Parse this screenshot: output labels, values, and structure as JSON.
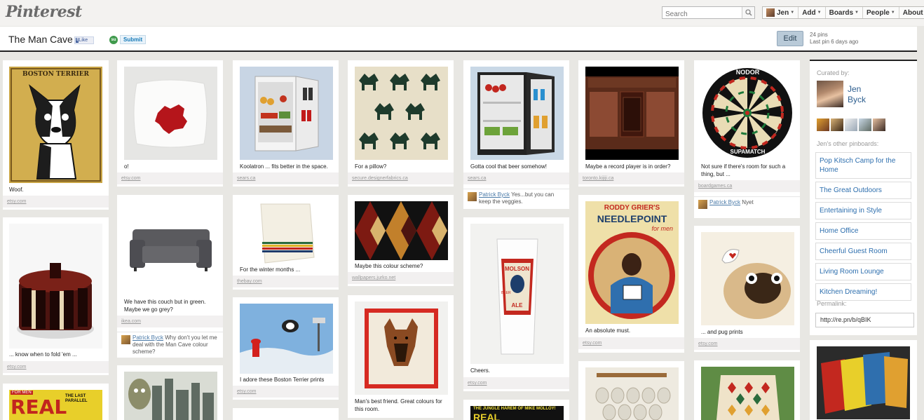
{
  "topbar": {
    "logo": "Pinterest",
    "search_placeholder": "Search",
    "nav": [
      {
        "label": "Jen"
      },
      {
        "label": "Add"
      },
      {
        "label": "Boards"
      },
      {
        "label": "People"
      },
      {
        "label": "About"
      }
    ]
  },
  "board": {
    "title": "The Man Cave",
    "fb_like": "Like",
    "su_label": "Submit",
    "edit": "Edit",
    "pin_count": "24 pins",
    "last_pin": "Last pin 6 days ago"
  },
  "pins": [
    {
      "caption": "Woof.",
      "source": "etsy.com"
    },
    {
      "caption": "... know when to fold 'em ...",
      "source": "etsy.com"
    },
    {
      "caption": "o!",
      "source": "etsy.com"
    },
    {
      "caption": "We have this couch but in green. Maybe we go grey?",
      "source": "ikea.com",
      "commenter": "Patrick Byck",
      "comment": "Why don't you let me deal with the Man Cave colour scheme?"
    },
    {
      "caption": "Koolatron ... fits better in the space.",
      "source": "sears.ca"
    },
    {
      "caption": "For the winter months ...",
      "source": "thebay.com"
    },
    {
      "caption": "I adore these Boston Terrier prints",
      "source": "etsy.com"
    },
    {
      "caption": "For a pillow?",
      "source": "secure.designerfabrics.ca"
    },
    {
      "caption": "Maybe this colour scheme?",
      "source": "wallpapers.jurko.net"
    },
    {
      "caption": "Man's best friend. Great colours for this room.",
      "source": ""
    },
    {
      "caption": "Gotta cool that beer somehow!",
      "source": "sears.ca",
      "commenter": "Patrick Byck",
      "comment": "Yes...but you can keep the veggies."
    },
    {
      "caption": "Cheers.",
      "source": "etsy.com"
    },
    {
      "caption": "Maybe a record player is in order?",
      "source": "toronto.kijiji.ca"
    },
    {
      "caption": "An absolute must.",
      "source": "etsy.com"
    },
    {
      "caption": "Not sure if there's room for such a thing, but ...",
      "source": "boardgames.ca",
      "commenter": "Patrick Byck",
      "comment": "Nyet"
    },
    {
      "caption": "... and pug prints",
      "source": "etsy.com"
    }
  ],
  "sidebar": {
    "curated_by": "Curated by:",
    "curator_first": "Jen",
    "curator_last": "Byck",
    "other_boards_label": "Jen's other pinboards:",
    "boards": [
      "Pop Kitsch Camp for the Home",
      "The Great Outdoors",
      "Entertaining in Style",
      "Home Office",
      "Cheerful Guest Room",
      "Living Room Lounge",
      "Kitchen Dreaming!"
    ],
    "permalink_label": "Permalink:",
    "permalink": "http://re.pn/b/qBIK"
  },
  "image_text": {
    "boston": "BOSTON TERRIER",
    "molson1": "MOLSON",
    "molson2": "BEER",
    "molson3": "ALE",
    "rodney1": "RODDY GRIER'S",
    "rodney2": "NEEDLEPOINT",
    "rodney3": "for men",
    "nodor": "NODOR",
    "supamatch": "SUPAMATCH",
    "real_forman": "FOR MEN",
    "real": "REAL",
    "last_parallel": "THE LAST PARALLEL",
    "jungle": "THE JUNGLE HAREM OF MIKE MOLLOY!",
    "jungle_real": "REAL"
  },
  "colors": {
    "background": "#e8e7e3",
    "link": "#2e6fae",
    "accent": "#b9cad8"
  }
}
